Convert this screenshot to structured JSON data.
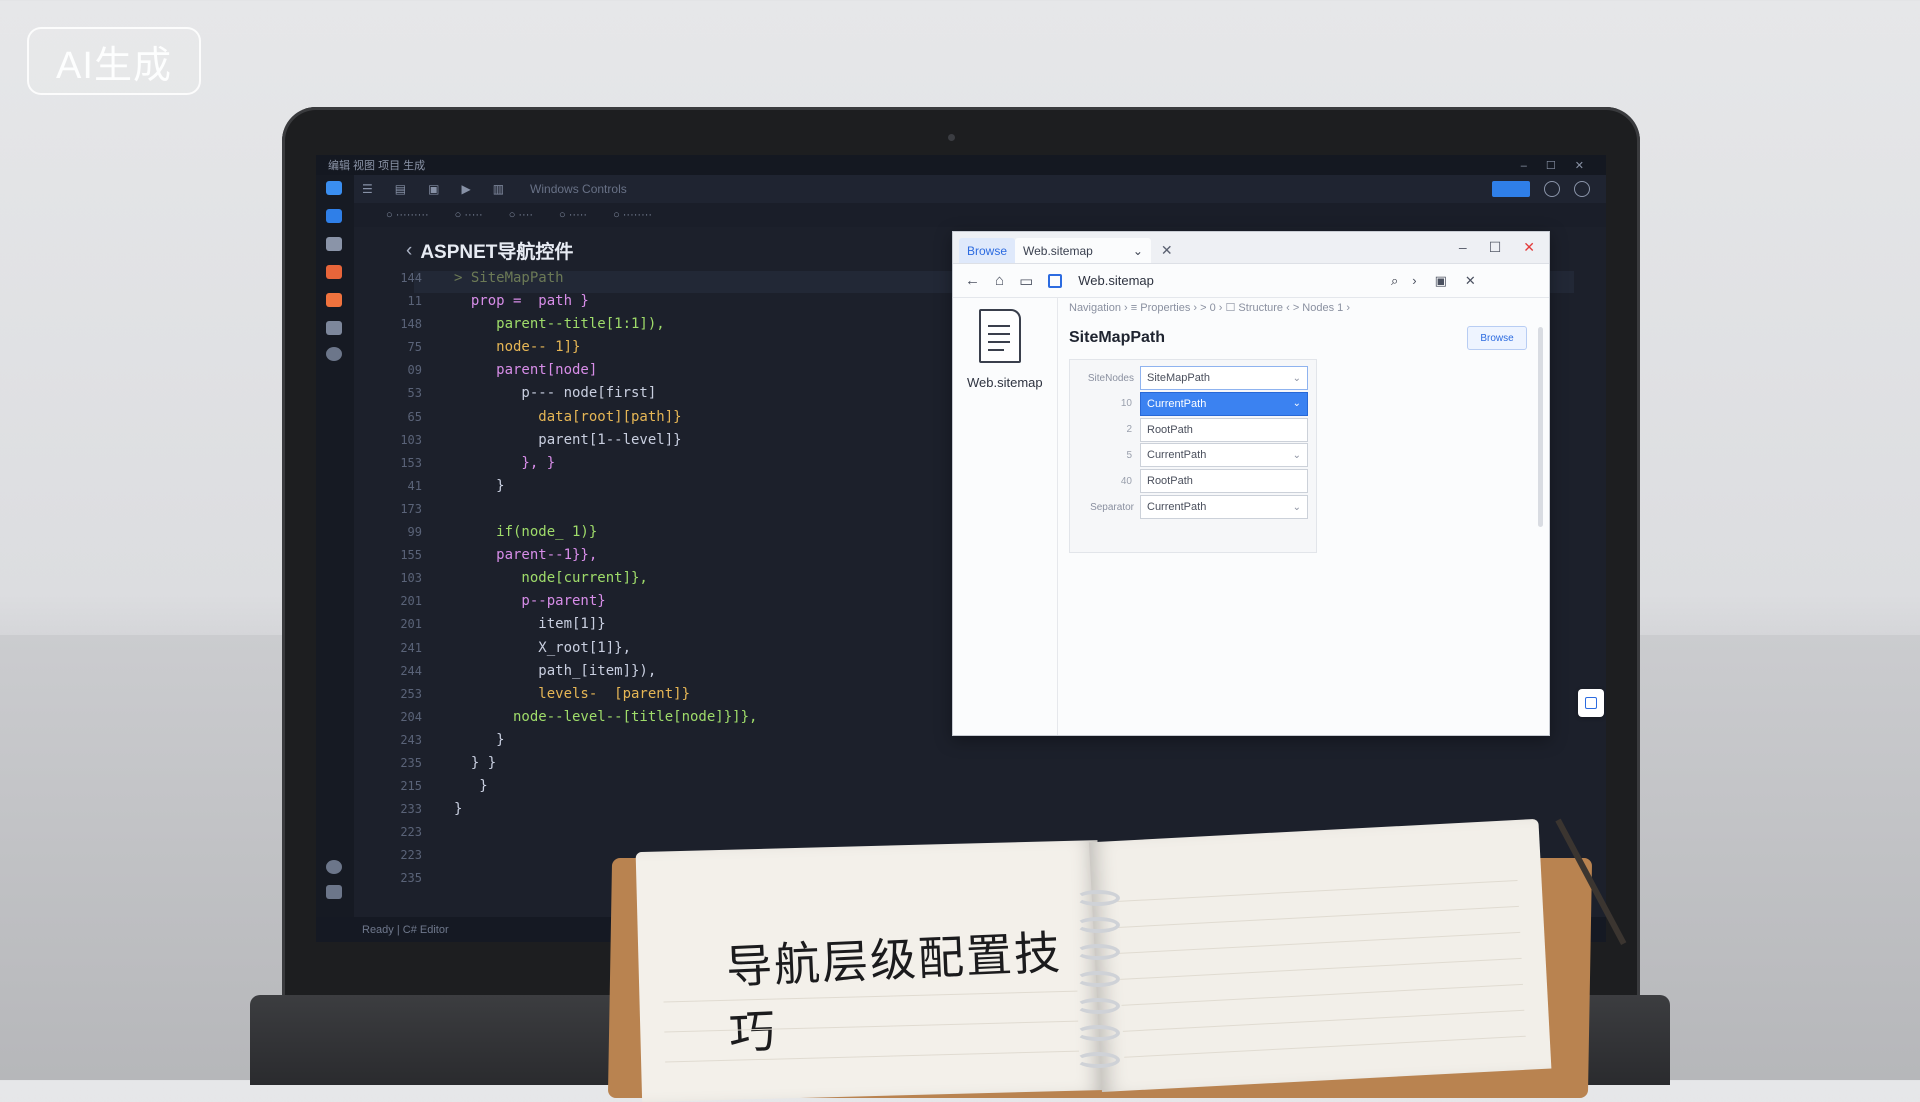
{
  "badge": "AI生成",
  "ide": {
    "menu": "编辑 视图 项目 生成",
    "toolbar_filler": "Windows Controls",
    "editor_title": "ASPNET导航控件",
    "status": "Ready | C# Editor"
  },
  "gutter": [
    "144",
    "11",
    "148",
    "75",
    "09",
    "53",
    "65",
    "103",
    "153",
    "41",
    "173",
    "99",
    "155",
    "103",
    "201",
    "201",
    "241",
    "244",
    "253",
    "204",
    "243",
    "235",
    "215",
    "233",
    "223",
    "223",
    "235"
  ],
  "code": [
    {
      "cls": "c-cm",
      "text": "> SiteMapPath"
    },
    {
      "cls": "c-kw",
      "text": "  prop =  path }"
    },
    {
      "cls": "c-fn",
      "text": "     parent--title[1:1]),"
    },
    {
      "cls": "c-str",
      "text": "     node-- 1]}"
    },
    {
      "cls": "c-kw",
      "text": "     parent[node]"
    },
    {
      "cls": "c-pn",
      "text": "        p--- node[first]"
    },
    {
      "cls": "c-str",
      "text": "          data[root][path]}"
    },
    {
      "cls": "c-pn",
      "text": "          parent[1--level]}"
    },
    {
      "cls": "c-kw",
      "text": "        }, }"
    },
    {
      "cls": "c-pn",
      "text": "     }"
    },
    {
      "cls": "c-pn",
      "text": ""
    },
    {
      "cls": "c-fn",
      "text": "     if(node_ 1)}"
    },
    {
      "cls": "c-kw",
      "text": "     parent--1}},"
    },
    {
      "cls": "c-fn",
      "text": "        node[current]},"
    },
    {
      "cls": "c-kw",
      "text": "        p--parent}"
    },
    {
      "cls": "c-pn",
      "text": "          item[1]}"
    },
    {
      "cls": "c-pn",
      "text": "          X_root[1]},"
    },
    {
      "cls": "c-pn",
      "text": "          path_[item]}),"
    },
    {
      "cls": "c-str",
      "text": "          levels-  [parent]}"
    },
    {
      "cls": "c-fn",
      "text": "       node--level--[title[node]}]},"
    },
    {
      "cls": "c-pn",
      "text": "     }"
    },
    {
      "cls": "c-pn",
      "text": "  } }"
    },
    {
      "cls": "c-pn",
      "text": "   }"
    },
    {
      "cls": "c-pn",
      "text": "}"
    }
  ],
  "dialog": {
    "home_tab": "Browse",
    "tab": "Web.sitemap",
    "address": "Web.sitemap",
    "file_label": "Web.sitemap",
    "breadcrumb": "Navigation  ›  ≡ Properties  ›  > 0  ›  ☐ Structure ‹  > Nodes  1 ›",
    "title": "SiteMapPath",
    "action": "Browse",
    "rows": [
      {
        "label": "SiteNodes",
        "num": "",
        "value": "SiteMapPath",
        "dropdown": true,
        "state": "top"
      },
      {
        "label": "",
        "num": "10",
        "value": "CurrentPath",
        "dropdown": true,
        "state": "selected"
      },
      {
        "label": "",
        "num": "2",
        "value": "RootPath",
        "dropdown": false,
        "state": "normal"
      },
      {
        "label": "",
        "num": "5",
        "value": "CurrentPath",
        "dropdown": true,
        "state": "normal"
      },
      {
        "label": "",
        "num": "40",
        "value": "RootPath",
        "dropdown": false,
        "state": "normal"
      },
      {
        "label": "Separator",
        "num": "",
        "value": "CurrentPath",
        "dropdown": true,
        "state": "normal"
      }
    ]
  },
  "notebook": {
    "heading": "导航层级配置技巧"
  }
}
